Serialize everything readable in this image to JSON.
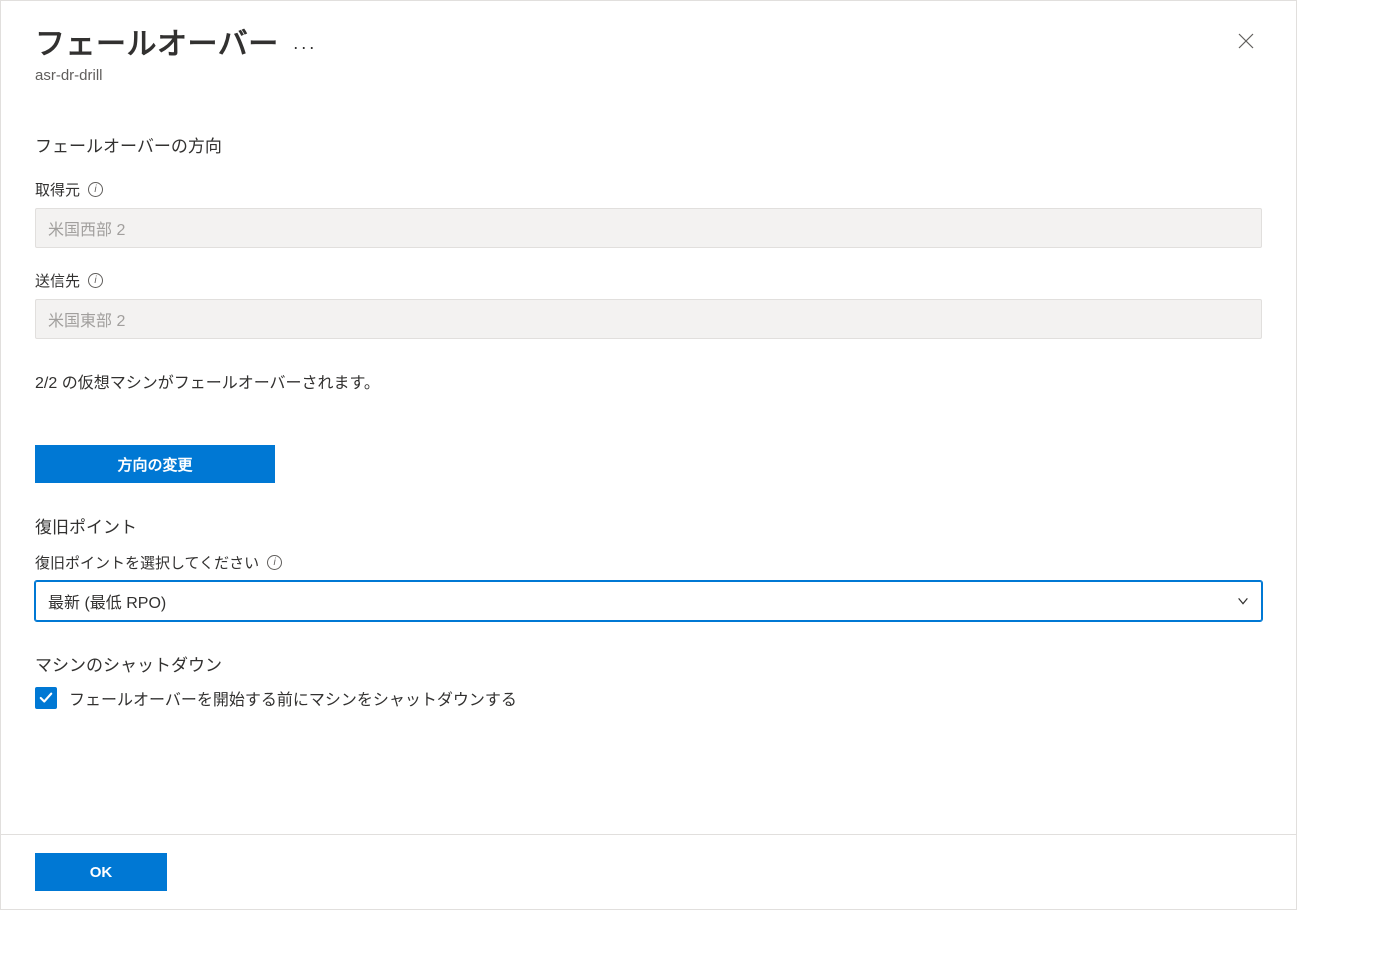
{
  "header": {
    "title": "フェールオーバー",
    "resource": "asr-dr-drill"
  },
  "direction": {
    "heading": "フェールオーバーの方向",
    "from_label": "取得元",
    "from_value": "米国西部 2",
    "to_label": "送信先",
    "to_value": "米国東部 2",
    "note": "2/2 の仮想マシンがフェールオーバーされます。",
    "change_button": "方向の変更"
  },
  "recovery": {
    "heading": "復旧ポイント",
    "select_label": "復旧ポイントを選択してください",
    "selected_value": "最新 (最低 RPO)"
  },
  "shutdown": {
    "heading": "マシンのシャットダウン",
    "checkbox_label": "フェールオーバーを開始する前にマシンをシャットダウンする",
    "checked": true
  },
  "footer": {
    "ok": "OK"
  }
}
